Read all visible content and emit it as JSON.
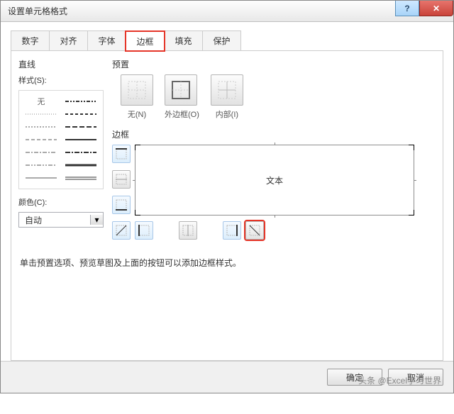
{
  "window": {
    "title": "设置单元格格式"
  },
  "tabs": {
    "items": [
      "数字",
      "对齐",
      "字体",
      "边框",
      "填充",
      "保护"
    ],
    "active_index": 3
  },
  "line_section": {
    "heading": "直线",
    "style_label": "样式(S):",
    "none_label": "无",
    "color_label": "颜色(C):",
    "color_value": "自动"
  },
  "preset_section": {
    "heading": "预置",
    "none": "无(N)",
    "outline": "外边框(O)",
    "inside": "内部(I)"
  },
  "border_section": {
    "heading": "边框",
    "preview_text": "文本"
  },
  "hint": "单击预置选项、预览草图及上面的按钮可以添加边框样式。",
  "footer": {
    "ok": "确定",
    "cancel": "取消"
  },
  "watermark": "头条 @Excel学习世界"
}
